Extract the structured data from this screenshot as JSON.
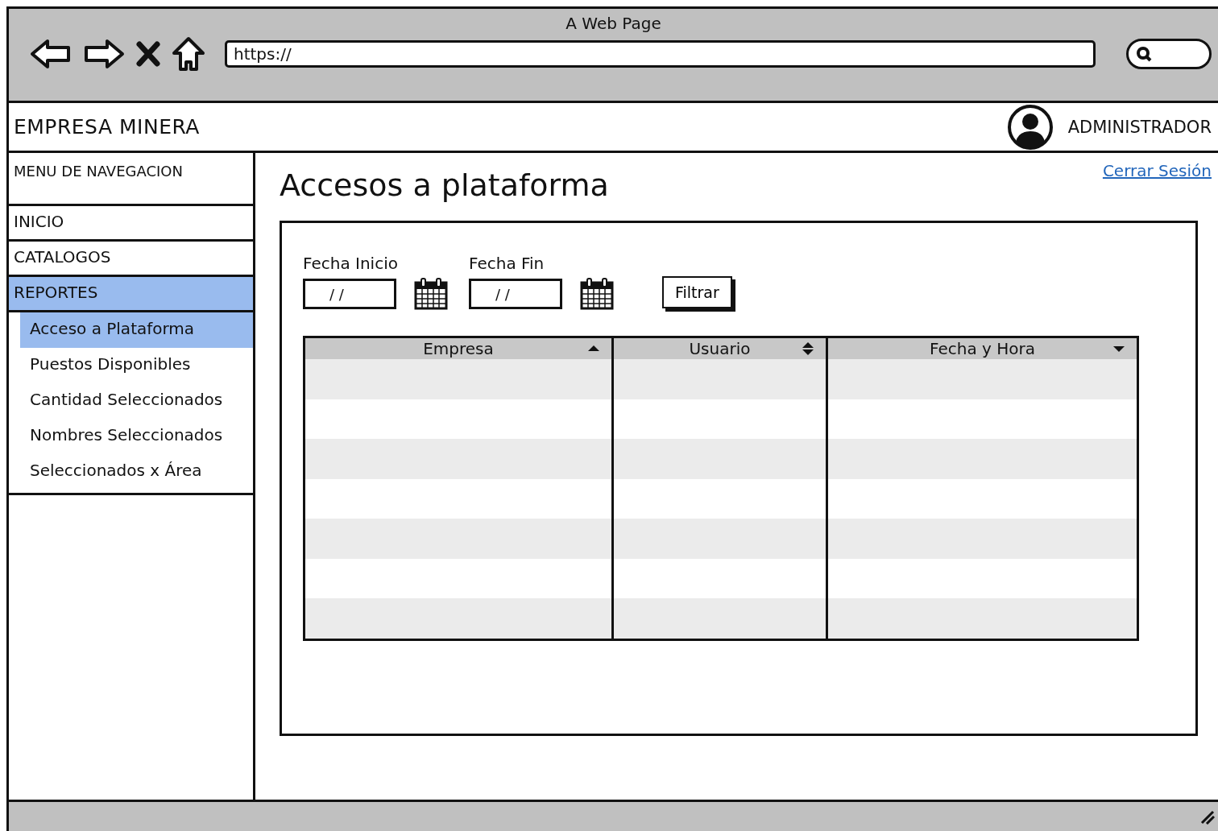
{
  "window": {
    "title": "A Web Page",
    "url": "https://"
  },
  "header": {
    "brand": "EMPRESA MINERA",
    "user": "ADMINISTRADOR"
  },
  "sidebar": {
    "title": "MENU DE NAVEGACION",
    "items": [
      {
        "label": "INICIO",
        "selected": false
      },
      {
        "label": "CATALOGOS",
        "selected": false
      },
      {
        "label": "REPORTES",
        "selected": true,
        "expanded": true,
        "children": [
          {
            "label": "Acceso a Plataforma",
            "selected": true
          },
          {
            "label": "Puestos Disponibles",
            "selected": false
          },
          {
            "label": "Cantidad Seleccionados",
            "selected": false
          },
          {
            "label": "Nombres Seleccionados",
            "selected": false
          },
          {
            "label": "Seleccionados x Área",
            "selected": false
          }
        ]
      }
    ]
  },
  "page": {
    "title": "Accesos a plataforma",
    "logout": "Cerrar Sesión"
  },
  "filters": {
    "fields": [
      {
        "label": "Fecha Inicio",
        "value": "/ /"
      },
      {
        "label": "Fecha Fin",
        "value": "/ /"
      }
    ],
    "button": "Filtrar"
  },
  "table": {
    "columns": [
      {
        "label": "Empresa",
        "kind": "ascending"
      },
      {
        "label": "Usuario",
        "kind": "sortable"
      },
      {
        "label": "Fecha y Hora",
        "kind": "descending"
      }
    ]
  }
}
